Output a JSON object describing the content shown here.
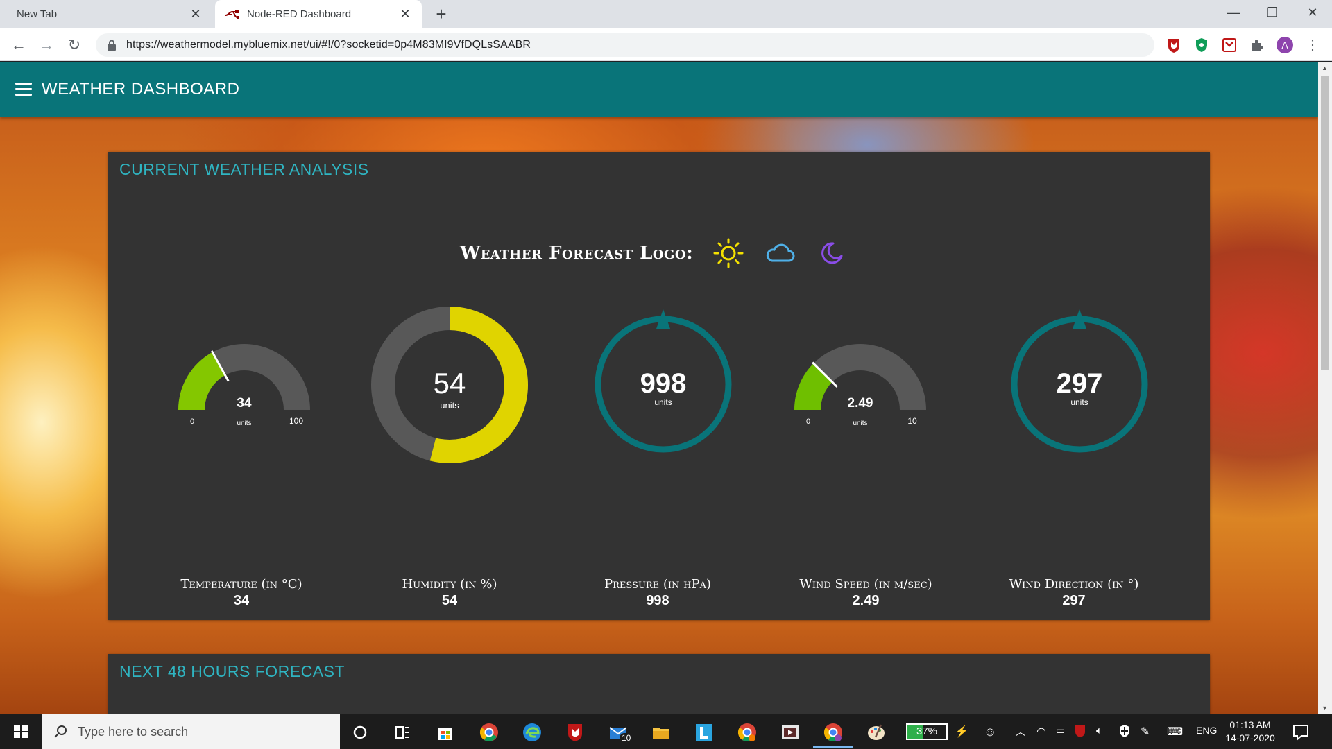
{
  "browser": {
    "tabs": [
      {
        "label": "New Tab",
        "active": false
      },
      {
        "label": "Node-RED Dashboard",
        "active": true
      }
    ],
    "url": "https://weathermodel.mybluemix.net/ui/#!/0?socketid=0p4M83MI9VfDQLsSAABR",
    "profile_initial": "A"
  },
  "app": {
    "title": "WEATHER DASHBOARD",
    "accent_color": "#097479"
  },
  "current": {
    "title": "CURRENT WEATHER ANALYSIS",
    "logo_label": "Weather Forecast Logo:",
    "logo_icons": [
      "sun-icon",
      "cloud-icon",
      "moon-icon"
    ],
    "gauges": [
      {
        "id": "temperature",
        "type": "gage",
        "value": "34",
        "units": "units",
        "min": "0",
        "max": "100",
        "fill_fraction": 0.34,
        "color": "#84c700",
        "label": "Temperature (in °C)",
        "display": "34"
      },
      {
        "id": "humidity",
        "type": "donut",
        "value": "54",
        "units": "units",
        "fill_fraction": 0.54,
        "color": "#e0d400",
        "label": "Humidity (in %)",
        "display": "54"
      },
      {
        "id": "pressure",
        "type": "compass",
        "value": "998",
        "units": "units",
        "color": "#097479",
        "label": "Pressure (in hPa)",
        "display": "998"
      },
      {
        "id": "wind-speed",
        "type": "gage",
        "value": "2.49",
        "units": "units",
        "min": "0",
        "max": "10",
        "fill_fraction": 0.249,
        "color": "#6fbf00",
        "label": "Wind Speed (in m/sec)",
        "display": "2.49"
      },
      {
        "id": "wind-direction",
        "type": "compass",
        "value": "297",
        "units": "units",
        "color": "#097479",
        "label": "Wind Direction (in °)",
        "display": "297"
      }
    ]
  },
  "forecast": {
    "title": "NEXT 48 HOURS FORECAST"
  },
  "taskbar": {
    "search_placeholder": "Type here to search",
    "battery": "37%",
    "language": "ENG",
    "time": "01:13 AM",
    "date": "14-07-2020",
    "mail_badge": "10"
  }
}
